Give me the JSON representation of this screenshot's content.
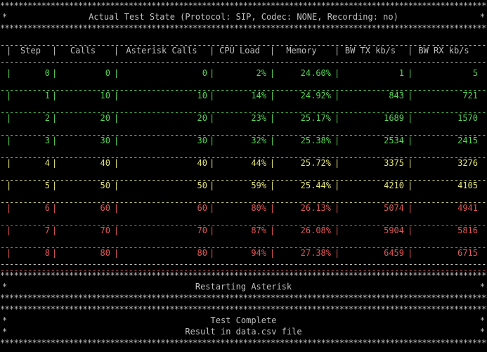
{
  "header": {
    "title": "Actual Test State (Protocol: SIP, Codec: NONE, Recording: no)"
  },
  "table": {
    "columns": [
      "Step",
      "Calls",
      "Asterisk Calls",
      "CPU Load",
      "Memory",
      "BW TX kb/s",
      "BW RX kb/s"
    ],
    "rows": [
      {
        "status": "ok",
        "cells": [
          "0",
          "0",
          "0",
          "2%",
          "24.60%",
          "1",
          "5"
        ]
      },
      {
        "status": "ok",
        "cells": [
          "1",
          "10",
          "10",
          "14%",
          "24.92%",
          "843",
          "721"
        ]
      },
      {
        "status": "ok",
        "cells": [
          "2",
          "20",
          "20",
          "23%",
          "25.17%",
          "1689",
          "1570"
        ]
      },
      {
        "status": "ok",
        "cells": [
          "3",
          "30",
          "30",
          "32%",
          "25.38%",
          "2534",
          "2415"
        ]
      },
      {
        "status": "warn",
        "cells": [
          "4",
          "40",
          "40",
          "44%",
          "25.72%",
          "3375",
          "3276"
        ]
      },
      {
        "status": "warn",
        "cells": [
          "5",
          "50",
          "50",
          "59%",
          "25.44%",
          "4210",
          "4105"
        ]
      },
      {
        "status": "bad",
        "cells": [
          "6",
          "60",
          "60",
          "80%",
          "26.13%",
          "5074",
          "4941"
        ]
      },
      {
        "status": "bad",
        "cells": [
          "7",
          "70",
          "70",
          "87%",
          "26.08%",
          "5904",
          "5816"
        ]
      },
      {
        "status": "bad",
        "cells": [
          "8",
          "80",
          "80",
          "94%",
          "27.38%",
          "6459",
          "6715"
        ]
      }
    ]
  },
  "messages": {
    "restarting": "Restarting Asterisk",
    "complete": "Test Complete",
    "result": "Result in data.csv file"
  },
  "border": {
    "star": "*",
    "dash": "-",
    "pipe": "|"
  },
  "colors": {
    "background": "#000000",
    "frame": "#c0c0c0",
    "ok": "#55d655",
    "warn": "#e5e57a",
    "bad": "#e05858"
  }
}
